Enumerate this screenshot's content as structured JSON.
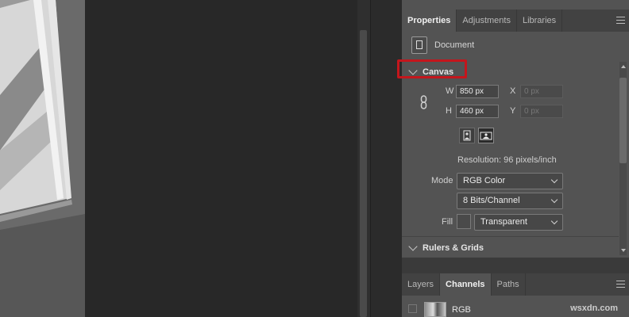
{
  "properties_tabs": [
    "Properties",
    "Adjustments",
    "Libraries"
  ],
  "document_label": "Document",
  "canvas": {
    "header": "Canvas",
    "w_label": "W",
    "w_value": "850 px",
    "h_label": "H",
    "h_value": "460 px",
    "x_label": "X",
    "x_placeholder": "0 px",
    "y_label": "Y",
    "y_placeholder": "0 px",
    "resolution": "Resolution: 96 pixels/inch",
    "mode_label": "Mode",
    "mode_value": "RGB Color",
    "bits_value": "8 Bits/Channel",
    "fill_label": "Fill",
    "fill_value": "Transparent"
  },
  "rulers_header": "Rulers & Grids",
  "layers_tabs": [
    "Layers",
    "Channels",
    "Paths"
  ],
  "channel_name": "RGB",
  "watermark": "wsxdn.com",
  "colors": {
    "highlight": "#c4161c",
    "panel_bg": "#535353"
  }
}
